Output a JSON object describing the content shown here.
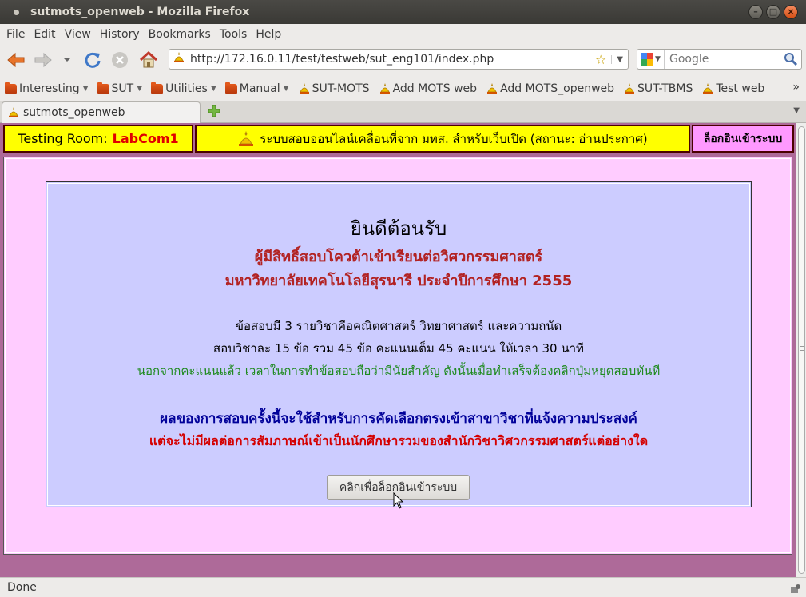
{
  "window": {
    "title": "sutmots_openweb - Mozilla Firefox"
  },
  "menu": [
    "File",
    "Edit",
    "View",
    "History",
    "Bookmarks",
    "Tools",
    "Help"
  ],
  "nav": {
    "url": "http://172.16.0.11/test/testweb/sut_eng101/index.php",
    "search_placeholder": "Google"
  },
  "bookmarks": {
    "folders": [
      "Interesting",
      "SUT",
      "Utilities",
      "Manual"
    ],
    "links": [
      "SUT-MOTS",
      "Add MOTS web",
      "Add MOTS_openweb",
      "SUT-TBMS",
      "Test web"
    ],
    "more": "»"
  },
  "tab": {
    "label": "sutmots_openweb"
  },
  "page": {
    "room_label": "Testing Room:",
    "room_name": "LabCom1",
    "system_title": "ระบบสอบออนไลน์เคลื่อนที่จาก มทส. สำหรับเว็บเปิด (สถานะ: อ่านประกาศ)",
    "login_link": "ล็อกอินเข้าระบบ",
    "welcome": {
      "title": "ยินดีต้อนรับ",
      "subtitle1": "ผู้มีสิทธิ์สอบโควต้าเข้าเรียนต่อวิศวกรรมศาสตร์",
      "subtitle2": "มหาวิทยาลัยเทคโนโลยีสุรนารี ประจำปีการศึกษา 2555",
      "line1": "ข้อสอบมี 3 รายวิชาคือคณิตศาสตร์ วิทยาศาสตร์ และความถนัด",
      "line2": "สอบวิชาละ 15 ข้อ รวม 45 ข้อ คะแนนเต็ม 45 คะแนน ให้เวลา 30 นาที",
      "line3": "นอกจากคะแนนแล้ว เวลาในการทำข้อสอบถือว่ามีนัยสำคัญ ดังนั้นเมื่อทำเสร็จต้องคลิกปุ่มหยุดสอบทันที",
      "line4": "ผลของการสอบครั้งนี้จะใช้สำหรับการคัดเลือกตรงเข้าสาขาวิชาที่แจ้งความประสงค์",
      "line5": "แต่จะไม่มีผลต่อการสัมภาษณ์เข้าเป็นนักศึกษารวมของสำนักวิชาวิศวกรรมศาสตร์แต่อย่างใด",
      "button": "คลิกเพื่อล็อกอินเข้าระบบ"
    }
  },
  "status": {
    "text": "Done"
  },
  "colors": {
    "page_bg": "#ae6a99",
    "content_bg": "#ffccff",
    "welcome_bg": "#ccccff",
    "header_yellow": "#ffff00",
    "login_pink": "#ff99ff"
  }
}
